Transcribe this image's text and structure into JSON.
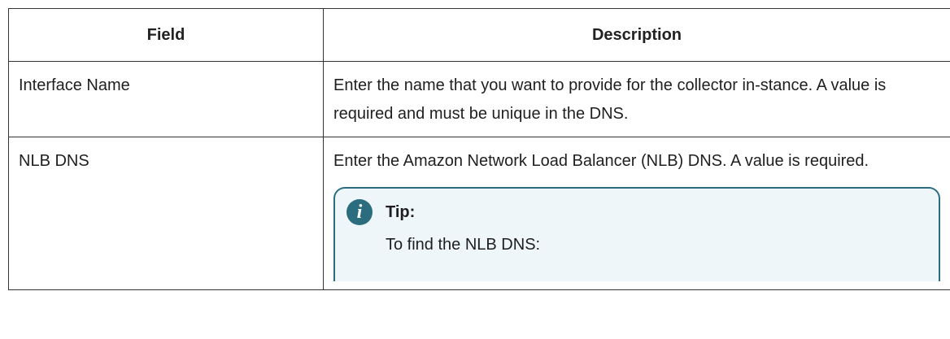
{
  "table": {
    "headers": {
      "field": "Field",
      "description": "Description"
    },
    "rows": [
      {
        "field": "Interface Name",
        "description": "Enter the name that you want to provide for the collector in-stance. A value is required and must be unique in the DNS."
      },
      {
        "field": "NLB DNS",
        "description": "Enter the Amazon Network Load Balancer (NLB) DNS. A value is required.",
        "tip": {
          "icon": "info-icon",
          "icon_glyph": "i",
          "title": "Tip:",
          "text": "To find the NLB DNS:"
        }
      }
    ]
  }
}
